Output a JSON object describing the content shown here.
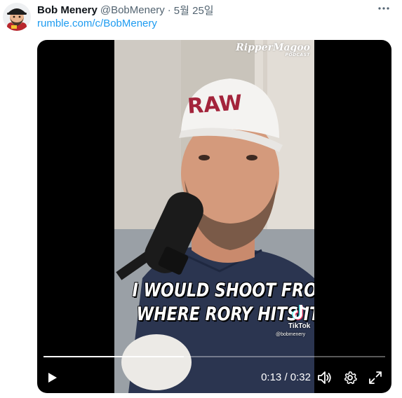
{
  "tweet": {
    "display_name": "Bob Menery",
    "handle": "@BobMenery",
    "separator": "·",
    "date": "5월 25일",
    "link_text": "rumble.com/c/BobMenery"
  },
  "video": {
    "watermark_title": "RipperMagoo",
    "watermark_subtitle": "PODCAST",
    "hat_text": "RAW",
    "caption_line1": "I WOULD SHOOT FROM",
    "caption_line2": "WHERE RORY HITS IT",
    "tiktok_label": "TikTok",
    "tiktok_user": "@bobmenery",
    "progress": 0.41,
    "current_time": "0:13",
    "time_separator": "/",
    "duration": "0:32"
  },
  "icons": {
    "more": "more-horizontal-icon",
    "play": "play-icon",
    "volume": "volume-icon",
    "settings": "gear-icon",
    "fullscreen": "fullscreen-icon",
    "tiktok": "tiktok-logo-icon"
  },
  "colors": {
    "link": "#1d9bf0",
    "secondary_text": "#536471",
    "primary_text": "#0f1419",
    "hat_text": "#a3243b"
  }
}
